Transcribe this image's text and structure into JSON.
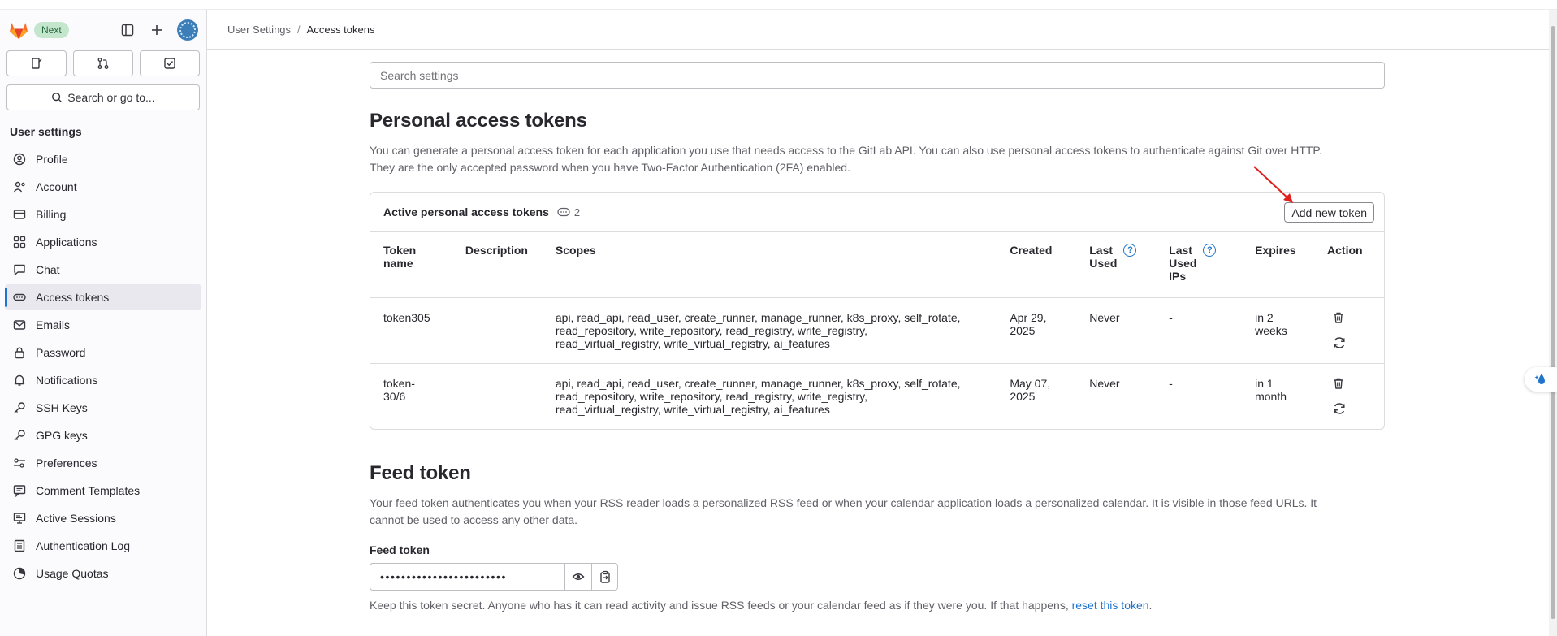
{
  "sidebar": {
    "badge": "Next",
    "search_label": "Search or go to...",
    "section_title": "User settings",
    "items": [
      {
        "label": "Profile",
        "icon": "profile-icon"
      },
      {
        "label": "Account",
        "icon": "account-icon"
      },
      {
        "label": "Billing",
        "icon": "billing-icon"
      },
      {
        "label": "Applications",
        "icon": "applications-icon"
      },
      {
        "label": "Chat",
        "icon": "chat-icon"
      },
      {
        "label": "Access tokens",
        "icon": "token-icon",
        "active": true
      },
      {
        "label": "Emails",
        "icon": "mail-icon"
      },
      {
        "label": "Password",
        "icon": "lock-icon"
      },
      {
        "label": "Notifications",
        "icon": "bell-icon"
      },
      {
        "label": "SSH Keys",
        "icon": "key-icon"
      },
      {
        "label": "GPG keys",
        "icon": "key-icon"
      },
      {
        "label": "Preferences",
        "icon": "preferences-icon"
      },
      {
        "label": "Comment Templates",
        "icon": "comment-icon"
      },
      {
        "label": "Active Sessions",
        "icon": "monitor-icon"
      },
      {
        "label": "Authentication Log",
        "icon": "log-icon"
      },
      {
        "label": "Usage Quotas",
        "icon": "quota-icon"
      }
    ]
  },
  "breadcrumb": {
    "parent": "User Settings",
    "separator": "/",
    "current": "Access tokens"
  },
  "search": {
    "placeholder": "Search settings"
  },
  "pat": {
    "title": "Personal access tokens",
    "description_line1": "You can generate a personal access token for each application you use that needs access to the GitLab API. You can also use personal access tokens to authenticate against Git over HTTP.",
    "description_line2": "They are the only accepted password when you have Two-Factor Authentication (2FA) enabled.",
    "card_title": "Active personal access tokens",
    "count": "2",
    "add_button": "Add new token",
    "columns": {
      "name_1": "Token",
      "name_2": "name",
      "description": "Description",
      "scopes": "Scopes",
      "created": "Created",
      "last_used_1": "Last",
      "last_used_2": "Used",
      "last_ips_1": "Last",
      "last_ips_2": "Used",
      "last_ips_3": "IPs",
      "expires": "Expires",
      "action": "Action"
    },
    "rows": [
      {
        "name_1": "token305",
        "name_2": "",
        "description": "",
        "scopes_1": "api, read_api, read_user, create_runner, manage_runner, k8s_proxy, self_rotate,",
        "scopes_2": "read_repository, write_repository, read_registry, write_registry,",
        "scopes_3": "read_virtual_registry, write_virtual_registry, ai_features",
        "created_1": "Apr 29,",
        "created_2": "2025",
        "last_used": "Never",
        "last_ips": "-",
        "expires_1": "in 2",
        "expires_2": "weeks"
      },
      {
        "name_1": "token-",
        "name_2": "30/6",
        "description": "",
        "scopes_1": "api, read_api, read_user, create_runner, manage_runner, k8s_proxy, self_rotate,",
        "scopes_2": "read_repository, write_repository, read_registry, write_registry,",
        "scopes_3": "read_virtual_registry, write_virtual_registry, ai_features",
        "created_1": "May 07,",
        "created_2": "2025",
        "last_used": "Never",
        "last_ips": "-",
        "expires_1": "in 1",
        "expires_2": "month"
      }
    ]
  },
  "feed": {
    "title": "Feed token",
    "description_line1": "Your feed token authenticates you when your RSS reader loads a personalized RSS feed or when your calendar application loads a personalized calendar. It is visible in those feed URLs. It",
    "description_line2": "cannot be used to access any other data.",
    "label": "Feed token",
    "masked_value": "••••••••••••••••••••••••",
    "note": "Keep this token secret. Anyone who has it can read activity and issue RSS feeds or your calendar feed as if they were you. If that happens, ",
    "reset_link": "reset this token",
    "note_end": "."
  },
  "colors": {
    "accent": "#1f75cb",
    "badge_bg": "#c3e6cd",
    "annotation": "#e0201c"
  }
}
